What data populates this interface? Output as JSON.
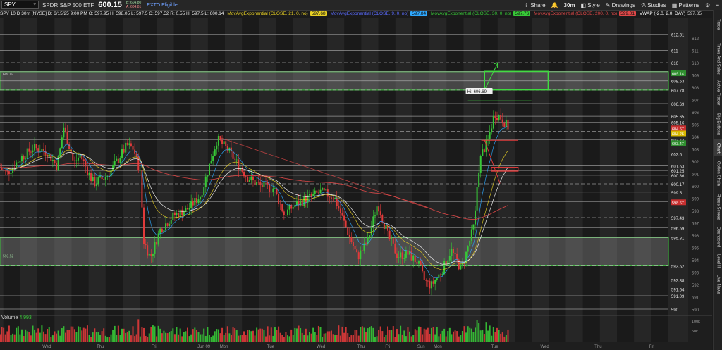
{
  "header": {
    "symbol": "SPY",
    "description": "SPDR S&P 500 ETF",
    "price": "600.15",
    "bid": "B: 604.80",
    "ask": "A: 604.81",
    "etb": "EXTO Eligible",
    "share": "Share",
    "timeframe": "30m",
    "style": "Style",
    "drawings": "Drawings",
    "studies": "Studies",
    "patterns": "Patterns"
  },
  "studies": {
    "ohlc": "SPY 10 D 30m [NYSE]   D: 6/15/25 9:00 PM   O: 597.95   H: 598.05   L: 597.5   C: 597.52   R: 0.55   H: 597.5   L: 600.14",
    "ema21_label": "MovAvgExponential (CLOSE, 21, 0, no)",
    "ema21_val": "597.68",
    "ema9_label": "MovAvgExponential (CLOSE, 9, 0, no)",
    "ema9_val": "597.84",
    "ema30_label": "MovAvgExponential (CLOSE, 30, 0, no)",
    "ema30_val": "597.76",
    "ema200_label": "MovAvgExponential (CLOSE, 200, 0, no)",
    "ema200_val": "599.01",
    "vwap_label": "VWAP (-2.0, 2.0, DAY)",
    "vwap_val": "597.85"
  },
  "volume": {
    "label": "Volume",
    "value": "4,993",
    "axis": [
      "100k",
      "50k"
    ]
  },
  "annotation": {
    "hi_label": "Hi: 606.69"
  },
  "overlay_labels": {
    "upper_zone": "609.07",
    "lower_zone": "593.52"
  },
  "colors": {
    "up": "#37c837",
    "down": "#e03a3a",
    "ema9": "#2ea8ff",
    "ema21": "#e8d024",
    "ema30": "#ffffff",
    "ema200": "#e04848",
    "zone": "#3fae3f"
  },
  "chart_data": {
    "type": "candlestick",
    "price_range": [
      589.6,
      613.6
    ],
    "ticks": [
      "590",
      "591",
      "592",
      "593",
      "594",
      "595",
      "596",
      "597",
      "598",
      "599",
      "600",
      "601",
      "602",
      "603",
      "604",
      "605",
      "606",
      "607",
      "608",
      "609",
      "610",
      "611",
      "612"
    ],
    "levels": [
      {
        "label": "612.31",
        "price": 612.31,
        "style": "solid"
      },
      {
        "label": "611",
        "price": 611.0,
        "style": "solid"
      },
      {
        "label": "610",
        "price": 610.0,
        "style": "dash"
      },
      {
        "label": "609.27",
        "price": 609.27,
        "style": "solid"
      },
      {
        "label": "608.53",
        "price": 608.53,
        "style": "solid"
      },
      {
        "label": "607.78",
        "price": 607.78,
        "style": "dash"
      },
      {
        "label": "606.69",
        "price": 606.69,
        "style": "solid"
      },
      {
        "label": "605.65",
        "price": 605.65,
        "style": "solid"
      },
      {
        "label": "605.16",
        "price": 605.16,
        "style": "solid"
      },
      {
        "label": "604.43",
        "price": 604.43,
        "style": "dash"
      },
      {
        "label": "603.74",
        "price": 603.74,
        "style": "solid"
      },
      {
        "label": "602.6",
        "price": 602.6,
        "style": "solid"
      },
      {
        "label": "601.63",
        "price": 601.63,
        "style": "solid"
      },
      {
        "label": "601.25",
        "price": 601.25,
        "style": "solid"
      },
      {
        "label": "600.86",
        "price": 600.86,
        "style": "solid"
      },
      {
        "label": "600.17",
        "price": 600.17,
        "style": "dash"
      },
      {
        "label": "599.5",
        "price": 599.5,
        "style": "solid"
      },
      {
        "label": "598.73",
        "price": 598.73,
        "style": "solid"
      },
      {
        "label": "597.43",
        "price": 597.43,
        "style": "dash"
      },
      {
        "label": "596.59",
        "price": 596.59,
        "style": "solid"
      },
      {
        "label": "595.81",
        "price": 595.81,
        "style": "solid"
      },
      {
        "label": "593.52",
        "price": 593.52,
        "style": "dash"
      },
      {
        "label": "592.38",
        "price": 592.38,
        "style": "solid"
      },
      {
        "label": "591.64",
        "price": 591.64,
        "style": "dash"
      },
      {
        "label": "591.09",
        "price": 591.09,
        "style": "solid"
      },
      {
        "label": "590",
        "price": 590.0,
        "style": "solid"
      }
    ],
    "price_tags": [
      {
        "label": "609.14",
        "price": 609.14,
        "color": "#2f8f2f"
      },
      {
        "label": "604.67",
        "price": 604.67,
        "color": "#c83030"
      },
      {
        "label": "604.26",
        "price": 604.26,
        "color": "#d8b800"
      },
      {
        "label": "603.47",
        "price": 603.47,
        "color": "#2f8f2f"
      },
      {
        "label": "598.67",
        "price": 598.67,
        "color": "#c83030"
      }
    ],
    "zones": [
      {
        "from": 607.78,
        "to": 609.27,
        "color": "#3fae3f"
      },
      {
        "from": 593.52,
        "to": 595.81,
        "color": "#3fae3f"
      }
    ],
    "day_labels": [
      {
        "label": "Wed",
        "pos": 0.07
      },
      {
        "label": "Thu",
        "pos": 0.15
      },
      {
        "label": "Fri",
        "pos": 0.23
      },
      {
        "label": "Jun 09",
        "pos": 0.305
      },
      {
        "label": "Mon",
        "pos": 0.335
      },
      {
        "label": "Tue",
        "pos": 0.405
      },
      {
        "label": "Wed",
        "pos": 0.48
      },
      {
        "label": "Thu",
        "pos": 0.54
      },
      {
        "label": "Fri",
        "pos": 0.58
      },
      {
        "label": "Sun",
        "pos": 0.63
      },
      {
        "label": "Mon",
        "pos": 0.655
      },
      {
        "label": "Tue",
        "pos": 0.74
      },
      {
        "label": "Wed",
        "pos": 0.815
      },
      {
        "label": "Thu",
        "pos": 0.895
      },
      {
        "label": "Fri",
        "pos": 0.975
      },
      {
        "label": "Sat",
        "pos": 1.06
      }
    ],
    "price_path": [
      [
        0,
        601.5
      ],
      [
        0.01,
        601.0
      ],
      [
        0.03,
        602.2
      ],
      [
        0.05,
        603.1
      ],
      [
        0.07,
        602.8
      ],
      [
        0.085,
        601.6
      ],
      [
        0.09,
        603.0
      ],
      [
        0.095,
        604.8
      ],
      [
        0.105,
        603.0
      ],
      [
        0.11,
        601.8
      ],
      [
        0.12,
        602.5
      ],
      [
        0.14,
        600.2
      ],
      [
        0.16,
        600.8
      ],
      [
        0.175,
        602.0
      ],
      [
        0.19,
        603.3
      ],
      [
        0.2,
        603.0
      ],
      [
        0.21,
        601.0
      ],
      [
        0.215,
        595.5
      ],
      [
        0.225,
        594.2
      ],
      [
        0.24,
        596.5
      ],
      [
        0.26,
        597.6
      ],
      [
        0.28,
        598.1
      ],
      [
        0.3,
        599.2
      ],
      [
        0.315,
        602.0
      ],
      [
        0.325,
        603.8
      ],
      [
        0.34,
        603.0
      ],
      [
        0.355,
        601.8
      ],
      [
        0.37,
        600.7
      ],
      [
        0.39,
        600.0
      ],
      [
        0.41,
        599.8
      ],
      [
        0.425,
        597.7
      ],
      [
        0.44,
        598.4
      ],
      [
        0.46,
        599.0
      ],
      [
        0.48,
        599.5
      ],
      [
        0.5,
        599.1
      ],
      [
        0.52,
        596.3
      ],
      [
        0.535,
        594.2
      ],
      [
        0.55,
        595.5
      ],
      [
        0.565,
        598.6
      ],
      [
        0.58,
        596.0
      ],
      [
        0.595,
        594.3
      ],
      [
        0.61,
        594.5
      ],
      [
        0.625,
        593.8
      ],
      [
        0.635,
        592.3
      ],
      [
        0.645,
        591.9
      ],
      [
        0.66,
        593.0
      ],
      [
        0.675,
        594.8
      ],
      [
        0.69,
        593.2
      ],
      [
        0.7,
        595.0
      ],
      [
        0.71,
        597.0
      ],
      [
        0.715,
        601.0
      ],
      [
        0.72,
        602.5
      ],
      [
        0.73,
        603.7
      ],
      [
        0.74,
        605.9
      ],
      [
        0.75,
        605.5
      ],
      [
        0.76,
        604.8
      ]
    ]
  }
}
